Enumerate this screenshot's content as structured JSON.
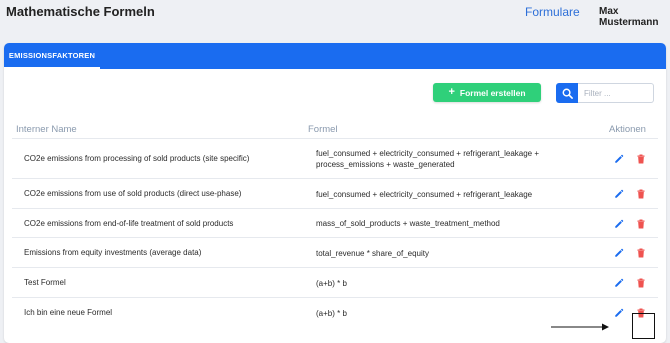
{
  "header": {
    "app_title": "Mathematische Formeln",
    "nav_link": "Formulare",
    "user_name": "Max Mustermann"
  },
  "card": {
    "tab_label": "EMISSIONSFAKTOREN",
    "create_button": "Formel erstellen",
    "filter_placeholder": "Filter ..."
  },
  "table": {
    "columns": [
      "Interner Name",
      "Formel",
      "Aktionen"
    ],
    "rows": [
      {
        "name": "CO2e emissions from processing of sold products (site specific)",
        "formula": [
          "fuel_consumed + electricity_consumed + refrigerant_leakage +",
          "process_emissions + waste_generated"
        ]
      },
      {
        "name": "CO2e emissions from use of sold products (direct use-phase)",
        "formula": [
          "fuel_consumed + electricity_consumed + refrigerant_leakage"
        ]
      },
      {
        "name": "CO2e emissions from end-of-life treatment of sold products",
        "formula": [
          "mass_of_sold_products + waste_treatment_method"
        ]
      },
      {
        "name": "Emissions from equity investments (average data)",
        "formula": [
          "total_revenue * share_of_equity"
        ]
      },
      {
        "name": "Test Formel",
        "formula": [
          "(a+b) * b"
        ]
      },
      {
        "name": "Ich bin eine neue Formel",
        "formula": [
          "(a+b) * b"
        ]
      }
    ]
  },
  "colors": {
    "primary": "#1a6cf0",
    "success": "#2fd07a",
    "edit_icon": "#1a6cf0",
    "delete_icon": "#ef5350"
  },
  "icons": {
    "edit": "pencil-icon",
    "delete": "trash-icon",
    "search": "search-icon",
    "create": "plus-icon"
  }
}
